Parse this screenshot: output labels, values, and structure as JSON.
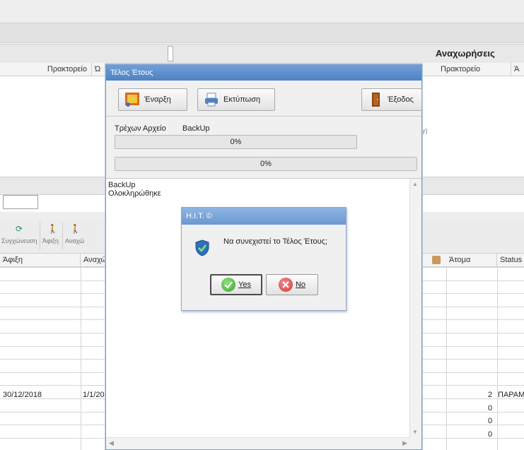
{
  "background": {
    "header_right": "Αναχωρήσεις",
    "top_cols_left": [
      "Πρακτορείο",
      "Ώ"
    ],
    "top_cols_right": [
      "Πρακτορείο",
      "Ά"
    ],
    "toolbar": [
      {
        "label": "Συγχώνευση",
        "icon": "sync-icon"
      },
      {
        "label": "Άφιξη",
        "icon": "arrival-icon"
      },
      {
        "label": "Αναχώ",
        "icon": "departure-icon"
      }
    ],
    "grid_cols_left": [
      "Άφιξη",
      "Αναχώ"
    ],
    "grid_cols_right": [
      "Άτομα",
      "Status"
    ],
    "side_note": "y)",
    "row_main": {
      "arrival": "30/12/2018",
      "departure": "1/1/20",
      "persons": "2",
      "status": "ΠΑΡΑΜ"
    },
    "rows_persons": [
      "0",
      "0",
      "0"
    ]
  },
  "dialog": {
    "title": "Τέλος Έτους",
    "buttons": {
      "start": "Έναρξη",
      "print": "Εκτύπωση",
      "exit": "Έξοδος"
    },
    "current_file_label": "Τρέχων Αρχείο",
    "current_file_value": "BackUp",
    "progress_file": {
      "text": "0%",
      "value": 0
    },
    "progress_total": {
      "text": "0%",
      "value": 0
    },
    "log_lines": [
      "BackUp",
      "Ολοκληρώθηκε"
    ]
  },
  "confirm": {
    "title": "H.I.T. ©",
    "message": "Να συνεχιστεί το Τέλος Έτους;",
    "yes": "Yes",
    "no": "No"
  },
  "colors": {
    "title_bar": "#4f82c2",
    "confirm_title": "#6a98d2",
    "yes_green": "#3fa535",
    "no_red": "#d23a3a"
  }
}
